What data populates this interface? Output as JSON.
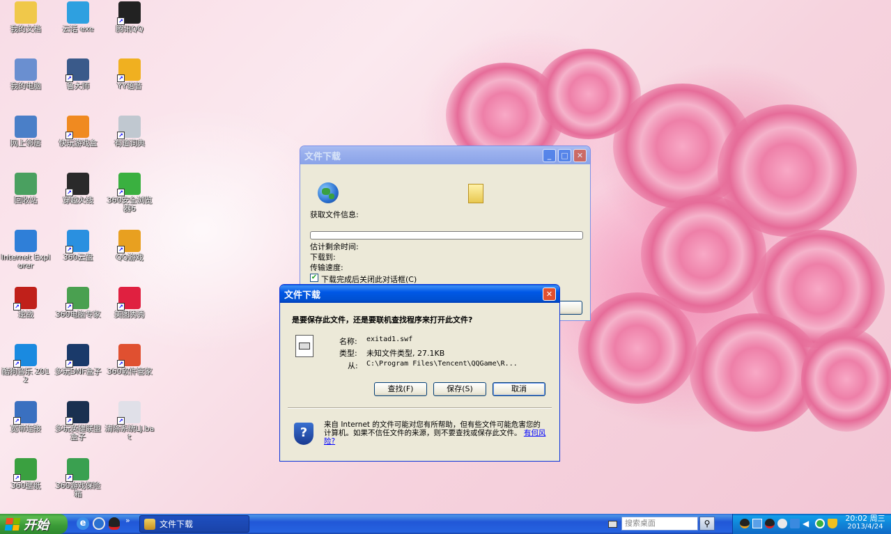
{
  "desktop": {
    "icons": [
      {
        "label": "我的文档",
        "icon": "folder-documents-icon",
        "color": "#f0c84a",
        "col": 0,
        "row": 0,
        "shortcut": false
      },
      {
        "label": "我的电脑",
        "icon": "computer-icon",
        "color": "#6a8fd0",
        "col": 0,
        "row": 1,
        "shortcut": false
      },
      {
        "label": "网上邻居",
        "icon": "network-icon",
        "color": "#4a7fc8",
        "col": 0,
        "row": 2,
        "shortcut": false
      },
      {
        "label": "回收站",
        "icon": "recycle-bin-icon",
        "color": "#4aa060",
        "col": 0,
        "row": 3,
        "shortcut": false
      },
      {
        "label": "Internet Explorer",
        "icon": "internet-explorer-icon",
        "color": "#2f7fd8",
        "col": 0,
        "row": 4,
        "shortcut": false
      },
      {
        "label": "逆战",
        "icon": "game-nizhan-icon",
        "color": "#c0201a",
        "col": 0,
        "row": 5,
        "shortcut": true
      },
      {
        "label": "酷狗音乐 2012",
        "icon": "kugou-icon",
        "color": "#1a8ae0",
        "col": 0,
        "row": 6,
        "shortcut": true
      },
      {
        "label": "宽带连接",
        "icon": "broadband-connection-icon",
        "color": "#3a70c0",
        "col": 0,
        "row": 7,
        "shortcut": true
      },
      {
        "label": "360壁纸",
        "icon": "360-wallpaper-icon",
        "color": "#3aa040",
        "col": 0,
        "row": 8,
        "shortcut": true
      },
      {
        "label": "云话 exe",
        "icon": "cloud-chat-icon",
        "color": "#2ea0e0",
        "col": 1,
        "row": 0,
        "shortcut": false
      },
      {
        "label": "鲁大师",
        "icon": "ludashi-icon",
        "color": "#3a5a8a",
        "col": 1,
        "row": 1,
        "shortcut": true
      },
      {
        "label": "快玩游戏盒",
        "icon": "kuaiwan-icon",
        "color": "#f08a20",
        "col": 1,
        "row": 2,
        "shortcut": true
      },
      {
        "label": "穿越火线",
        "icon": "crossfire-icon",
        "color": "#2a2a2a",
        "col": 1,
        "row": 3,
        "shortcut": true
      },
      {
        "label": "360云盘",
        "icon": "360-cloud-icon",
        "color": "#2a90e0",
        "col": 1,
        "row": 4,
        "shortcut": true
      },
      {
        "label": "360电脑专家",
        "icon": "360-expert-icon",
        "color": "#4aa050",
        "col": 1,
        "row": 5,
        "shortcut": true
      },
      {
        "label": "多玩DNF盒子",
        "icon": "duowan-dnf-icon",
        "color": "#1a3a6a",
        "col": 1,
        "row": 6,
        "shortcut": true
      },
      {
        "label": "多玩英雄联盟盒子",
        "icon": "duowan-lol-icon",
        "color": "#1a3050",
        "col": 1,
        "row": 7,
        "shortcut": true
      },
      {
        "label": "360游戏保险箱",
        "icon": "360-game-safe-icon",
        "color": "#3aa050",
        "col": 1,
        "row": 8,
        "shortcut": true
      },
      {
        "label": "腾讯QQ",
        "icon": "qq-penguin-icon",
        "color": "#222222",
        "col": 2,
        "row": 0,
        "shortcut": true
      },
      {
        "label": "YY语音",
        "icon": "yy-voice-icon",
        "color": "#f0b020",
        "col": 2,
        "row": 1,
        "shortcut": true
      },
      {
        "label": "有道词典",
        "icon": "youdao-dict-icon",
        "color": "#c0c8d0",
        "col": 2,
        "row": 2,
        "shortcut": true
      },
      {
        "label": "360安全浏览器6",
        "icon": "360-browser-icon",
        "color": "#3ab040",
        "col": 2,
        "row": 3,
        "shortcut": true
      },
      {
        "label": "QQ游戏",
        "icon": "qq-game-icon",
        "color": "#e8a020",
        "col": 2,
        "row": 4,
        "shortcut": true
      },
      {
        "label": "美图秀秀",
        "icon": "meitu-icon",
        "color": "#e02040",
        "col": 2,
        "row": 5,
        "shortcut": true
      },
      {
        "label": "360软件管家",
        "icon": "360-software-icon",
        "color": "#e05030",
        "col": 2,
        "row": 6,
        "shortcut": true
      },
      {
        "label": "清除系统LJ.bat",
        "icon": "batch-file-icon",
        "color": "#e0e0e8",
        "col": 2,
        "row": 7,
        "shortcut": true
      }
    ]
  },
  "bg_dialog": {
    "title": "文件下载",
    "status_label": "获取文件信息:",
    "progress": 0,
    "remaining_label": "估计剩余时间:",
    "download_to_label": "下载到:",
    "speed_label": "传输速度:",
    "close_checkbox_label": "下载完成后关闭此对话框(C)",
    "close_checkbox_checked": true
  },
  "fg_dialog": {
    "title": "文件下载",
    "question": "是要保存此文件，还是要联机查找程序来打开此文件?",
    "name_label": "名称:",
    "name_value": "exitad1.swf",
    "type_label": "类型:",
    "type_value": "未知文件类型, 27.1KB",
    "from_label": "从:",
    "from_value": "C:\\Program Files\\Tencent\\QQGame\\R...",
    "find_button": "查找(F)",
    "save_button": "保存(S)",
    "cancel_button": "取消",
    "warning_text": "来自 Internet 的文件可能对您有所帮助，但有些文件可能危害您的计算机。如果不信任文件的来源，则不要查找或保存此文件。",
    "warning_link": "有何风险?"
  },
  "taskbar": {
    "start_label": "开始",
    "task_label": "文件下载",
    "search_placeholder": "搜索桌面",
    "clock_time": "20:02 周三",
    "clock_date": "2013/4/24"
  },
  "colors": {
    "accent": "#0058e6",
    "start": "#3a9a37",
    "link": "#0000ff"
  }
}
